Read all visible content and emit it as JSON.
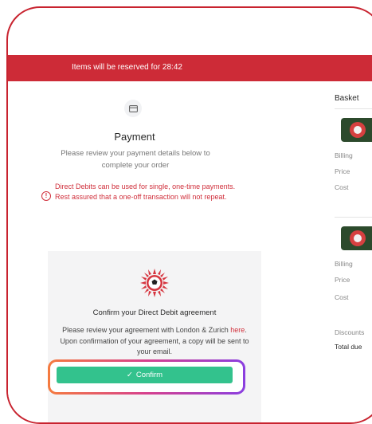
{
  "banner": {
    "reserved_text": "Items will be reserved for 28:42"
  },
  "payment": {
    "icon": "credit-card-icon",
    "title": "Payment",
    "subtitle": "Please review your payment details below to complete your order"
  },
  "warning": {
    "icon": "info-icon",
    "text": "Direct Debits can be used for single, one-time payments. Rest assured that a one-off transaction will not repeat."
  },
  "agreement": {
    "logo": "football-club-logo",
    "title": "Confirm your Direct Debit agreement",
    "text_before": "Please review your agreement with London & Zurich",
    "link_text": "here",
    "text_after": ". Upon confirmation of your agreement, a copy will be sent to your email."
  },
  "confirm_button": {
    "icon": "check-icon",
    "label": "Confirm"
  },
  "basket": {
    "title": "Basket",
    "items": [
      {
        "thumbnail": "football-icon",
        "billing_label": "Billing",
        "price_label": "Price",
        "cost_label": "Cost"
      },
      {
        "thumbnail": "football-icon",
        "billing_label": "Billing",
        "price_label": "Price",
        "cost_label": "Cost"
      }
    ],
    "discount_label": "Discounts",
    "total_label": "Total due"
  },
  "colors": {
    "accent_red": "#cd2b37",
    "confirm_green": "#33c28d",
    "highlight_start": "#f57b3f",
    "highlight_end": "#8a3ee0"
  }
}
